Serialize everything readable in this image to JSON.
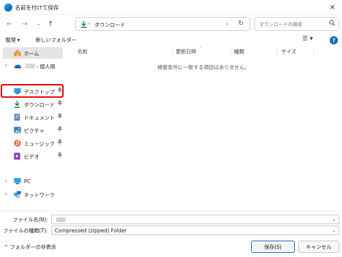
{
  "window": {
    "title": "名前を付けて保存",
    "close_glyph": "✕",
    "app_icon": "edge-browser-icon"
  },
  "nav": {
    "back_glyph": "←",
    "forward_glyph": "→",
    "recent_glyph": "⌄",
    "up_glyph": "↑",
    "address": "ダウンロード",
    "address_sep": "›",
    "address_chev": "⌄",
    "refresh_glyph": "↻",
    "search_placeholder": "ダウンロードの検索",
    "search_glyph": "⌕"
  },
  "toolbar": {
    "organize": "整理 ▾",
    "new_folder": "新しいフォルダー",
    "view": "☰ ▾",
    "help": "?"
  },
  "sidebar": {
    "items": [
      {
        "label": "ホーム",
        "icon": "home-icon"
      },
      {
        "label": "- 個人用",
        "icon": "onedrive-cloud-icon",
        "chev": "›"
      },
      {
        "label": "デスクトップ",
        "icon": "desktop-icon",
        "pin": "📌"
      },
      {
        "label": "ダウンロード",
        "icon": "download-icon",
        "pin": "📌"
      },
      {
        "label": "ドキュメント",
        "icon": "document-icon",
        "pin": "📌"
      },
      {
        "label": "ピクチャ",
        "icon": "pictures-icon",
        "pin": "📌"
      },
      {
        "label": "ミュージック",
        "icon": "music-icon",
        "pin": "📌"
      },
      {
        "label": "ビデオ",
        "icon": "video-icon",
        "pin": "📌"
      },
      {
        "label": "PC",
        "icon": "pc-icon",
        "chev": "›"
      },
      {
        "label": "ネットワーク",
        "icon": "network-icon",
        "chev": "›"
      }
    ]
  },
  "filelist": {
    "columns": [
      "名前",
      "更新日時",
      "種類",
      "サイズ"
    ],
    "empty_message": "検索条件に一致する項目はありません。"
  },
  "bottom": {
    "filename_label": "ファイル名(N):",
    "filename_value": "",
    "filetype_label": "ファイルの種類(T):",
    "filetype_value": "Compressed (zipped) Folder",
    "chev": "⌄",
    "hide_folders": "^ フォルダーの非表示",
    "save": "保存(S)",
    "cancel": "キャンセル"
  },
  "colors": {
    "accent": "#0f6cbd",
    "highlight": "#e10000",
    "hover_bg": "#e5e5e5"
  }
}
